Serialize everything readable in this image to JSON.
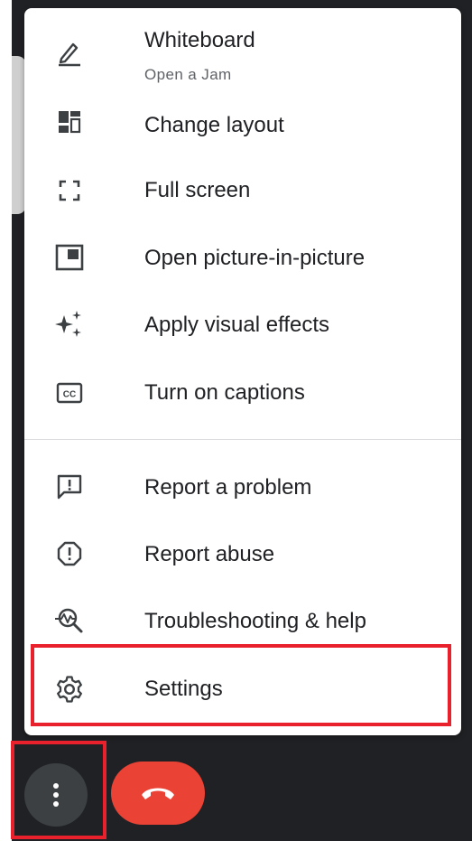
{
  "menu": {
    "items": [
      {
        "label": "Whiteboard",
        "sublabel": "Open a Jam",
        "icon": "pencil-icon"
      },
      {
        "label": "Change layout",
        "icon": "layout-icon"
      },
      {
        "label": "Full screen",
        "icon": "fullscreen-icon"
      },
      {
        "label": "Open picture-in-picture",
        "icon": "picture-in-picture-icon"
      },
      {
        "label": "Apply visual effects",
        "icon": "sparkle-icon"
      },
      {
        "label": "Turn on captions",
        "icon": "captions-icon"
      },
      {
        "label": "Report a problem",
        "icon": "feedback-icon"
      },
      {
        "label": "Report abuse",
        "icon": "report-icon"
      },
      {
        "label": "Troubleshooting & help",
        "icon": "troubleshoot-icon"
      },
      {
        "label": "Settings",
        "icon": "gear-icon"
      }
    ]
  },
  "controls": {
    "more_options_icon": "more-vert-icon",
    "end_call_icon": "call-end-icon"
  },
  "colors": {
    "highlight": "#e8212c",
    "end_call": "#ea4335",
    "stage": "#202124",
    "more_button": "#3c4043"
  }
}
